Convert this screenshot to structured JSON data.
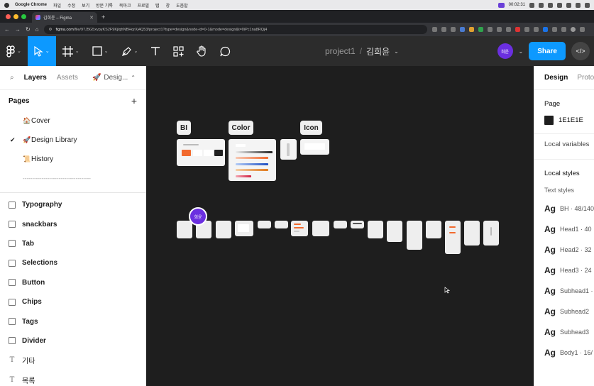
{
  "menubar": {
    "app_name": "Google Chrome",
    "items": [
      "파일",
      "수정",
      "보기",
      "방문 기록",
      "북마크",
      "프로필",
      "탭",
      "창",
      "도움말"
    ],
    "clock": "00:02:31"
  },
  "browser": {
    "tab_title": "김희윤 – Figma",
    "new_tab": "+",
    "url_host": "figma.com",
    "url_rest": "/file/97J5G5xvpyKS2F9KjlqhNBHqrXj4Q53/project1?type=design&node-id=0-1&mode=design&t=0iPc1na8RQj4"
  },
  "toolbar": {
    "file_name": "project1",
    "separator": "/",
    "page_name": "김희윤",
    "avatar_initials": "희윤",
    "share_label": "Share",
    "dev_label": "</>"
  },
  "left_panel": {
    "tabs": {
      "layers": "Layers",
      "assets": "Assets",
      "page_selector": "Desig..."
    },
    "pages_heading": "Pages",
    "add_icon": "+",
    "pages": [
      {
        "emoji": "🏠",
        "name": "Cover",
        "checked": false
      },
      {
        "emoji": "🚀",
        "name": "Design Library",
        "checked": true
      },
      {
        "emoji": "📜",
        "name": "History",
        "checked": false
      },
      {
        "emoji": "",
        "name": "------------------------------------",
        "checked": false
      }
    ],
    "layers": [
      {
        "icon": "frame",
        "name": "Typography",
        "bold": true
      },
      {
        "icon": "frame",
        "name": "snackbars",
        "bold": true
      },
      {
        "icon": "frame",
        "name": "Tab",
        "bold": true
      },
      {
        "icon": "frame",
        "name": "Selections",
        "bold": true
      },
      {
        "icon": "frame",
        "name": "Button",
        "bold": true
      },
      {
        "icon": "frame",
        "name": "Chips",
        "bold": true
      },
      {
        "icon": "frame",
        "name": "Tags",
        "bold": true
      },
      {
        "icon": "frame",
        "name": "Divider",
        "bold": true
      },
      {
        "icon": "text",
        "name": "기타",
        "bold": false
      },
      {
        "icon": "text",
        "name": "목록",
        "bold": false
      }
    ]
  },
  "canvas": {
    "section_labels": {
      "bi": "BI",
      "color": "Color",
      "icon": "Icon"
    },
    "cursor_avatar": "희윤",
    "colors": {
      "bg": "#1e1e1e",
      "accent": "#0d99ff",
      "orange": "#f26a2e",
      "purple": "#6b2fe0"
    }
  },
  "right_panel": {
    "tabs": {
      "design": "Design",
      "prototype": "Proto"
    },
    "page_heading": "Page",
    "page_color": "1E1E1E",
    "local_variables": "Local variables",
    "local_styles": "Local styles",
    "text_styles_heading": "Text styles",
    "ag": "Ag",
    "text_styles": [
      "BH · 48/140",
      "Head1 · 40",
      "Head2 · 32",
      "Head3 · 24",
      "Subhead1 ·",
      "Subhead2",
      "Subhead3",
      "Body1 · 16/"
    ]
  }
}
